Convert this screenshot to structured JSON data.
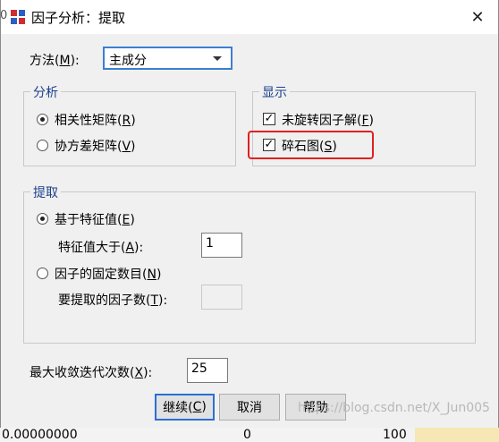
{
  "window": {
    "title": "因子分析：提取",
    "close_label": "✕"
  },
  "method": {
    "label_prefix": "方法(",
    "label_key": "M",
    "label_suffix": "):",
    "selected": "主成分"
  },
  "analysis_group": {
    "title": "分析",
    "options": [
      {
        "prefix": "相关性矩阵(",
        "key": "R",
        "suffix": ")",
        "selected": true
      },
      {
        "prefix": "协方差矩阵(",
        "key": "V",
        "suffix": ")",
        "selected": false
      }
    ]
  },
  "display_group": {
    "title": "显示",
    "options": [
      {
        "prefix": "未旋转因子解(",
        "key": "F",
        "suffix": ")",
        "checked": true
      },
      {
        "prefix": "碎石图(",
        "key": "S",
        "suffix": ")",
        "checked": true
      }
    ]
  },
  "extract_group": {
    "title": "提取",
    "eigen_option": {
      "prefix": "基于特征值(",
      "key": "E",
      "suffix": ")",
      "selected": true
    },
    "eigen_label": {
      "prefix": "特征值大于(",
      "key": "A",
      "suffix": "):"
    },
    "eigen_value": "1",
    "fixed_option": {
      "prefix": "因子的固定数目(",
      "key": "N",
      "suffix": ")",
      "selected": false
    },
    "fixed_label": {
      "prefix": "要提取的因子数(",
      "key": "T",
      "suffix": "):"
    },
    "fixed_value": ""
  },
  "iterations": {
    "prefix": "最大收敛迭代次数(",
    "key": "X",
    "suffix": "):",
    "value": "25"
  },
  "buttons": {
    "continue": {
      "prefix": "继续(",
      "key": "C",
      "suffix": ")"
    },
    "cancel": "取消",
    "help": "帮助"
  },
  "background": {
    "left_edge_top": "0",
    "left_edge_bottom": "0",
    "row_value_1": "0.00000000",
    "row_value_2": "0",
    "row_value_3": "100"
  },
  "watermark": "https://blog.csdn.net/X_Jun005",
  "colors": {
    "highlight": "#e02020",
    "accent": "#2a6fd6",
    "legend_text": "#1a3f8a"
  }
}
